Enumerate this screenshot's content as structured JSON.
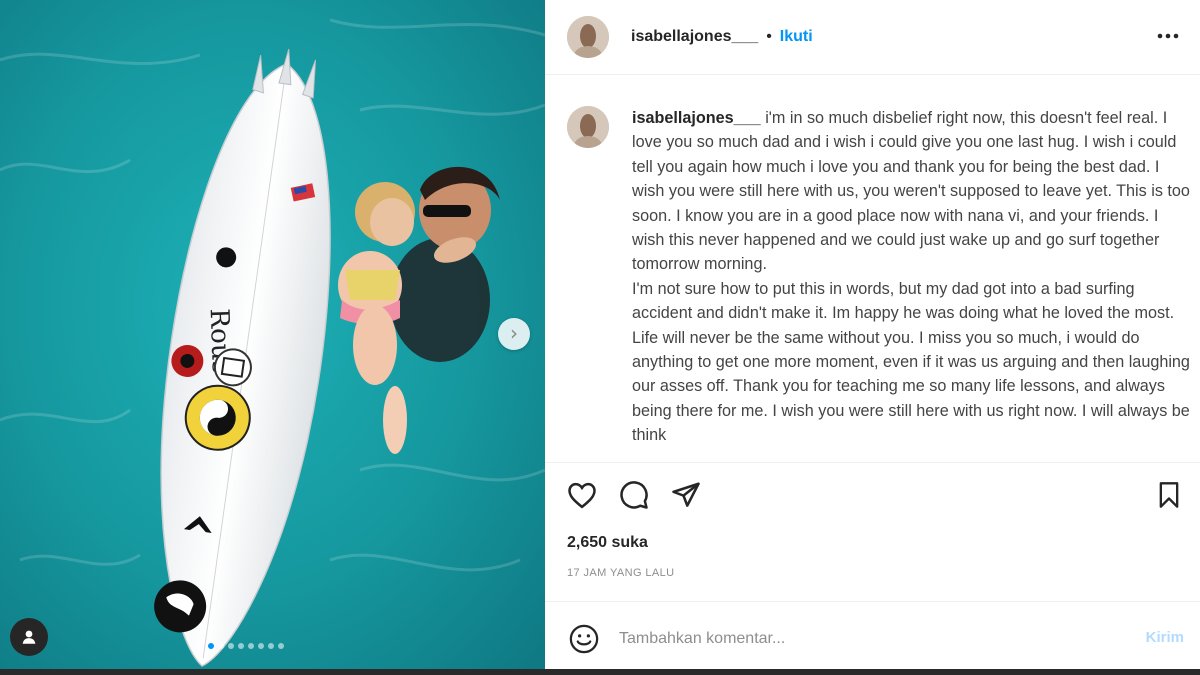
{
  "post": {
    "username": "isabellajones___",
    "follow_label": "Ikuti",
    "separator": "•",
    "caption": "i'm in so much disbelief right now, this doesn't feel real. I love you so much dad and i wish i could give you one last hug. I wish i could tell you again how much i love you and thank you for being the best dad. I wish you were still here with us, you weren't supposed to leave yet. This is too soon. I know you are in a good place now with nana vi, and your friends. I wish this never happened and we could just wake up and go surf together tomorrow morning.\nI'm not sure how to put this in words, but my dad got into a bad surfing accident and didn't make it. Im happy he was doing what he loved the most. Life will never be the same without you. I miss you so much, i would do anything to get one more moment, even if it was us arguing and then laughing our asses off. Thank you for teaching me so many life lessons, and always being there for me. I wish you were still here with us right now. I will always be think",
    "likes": "2,650 suka",
    "time_ago": "17 JAM YANG LALU"
  },
  "comment_box": {
    "placeholder": "Tambahkan komentar...",
    "post_label": "Kirim"
  },
  "carousel": {
    "slide_count": 8,
    "active_index": 0
  },
  "icons": {
    "more": "more-horizontal-icon",
    "like": "heart-icon",
    "comment": "comment-bubble-icon",
    "share": "paper-plane-icon",
    "save": "bookmark-icon",
    "emoji": "smiley-icon",
    "next": "chevron-right-icon",
    "tag": "user-tag-icon"
  },
  "colors": {
    "accent": "#0095f6",
    "post_disabled": "#b3dbff",
    "water": "#1fa3a8"
  }
}
